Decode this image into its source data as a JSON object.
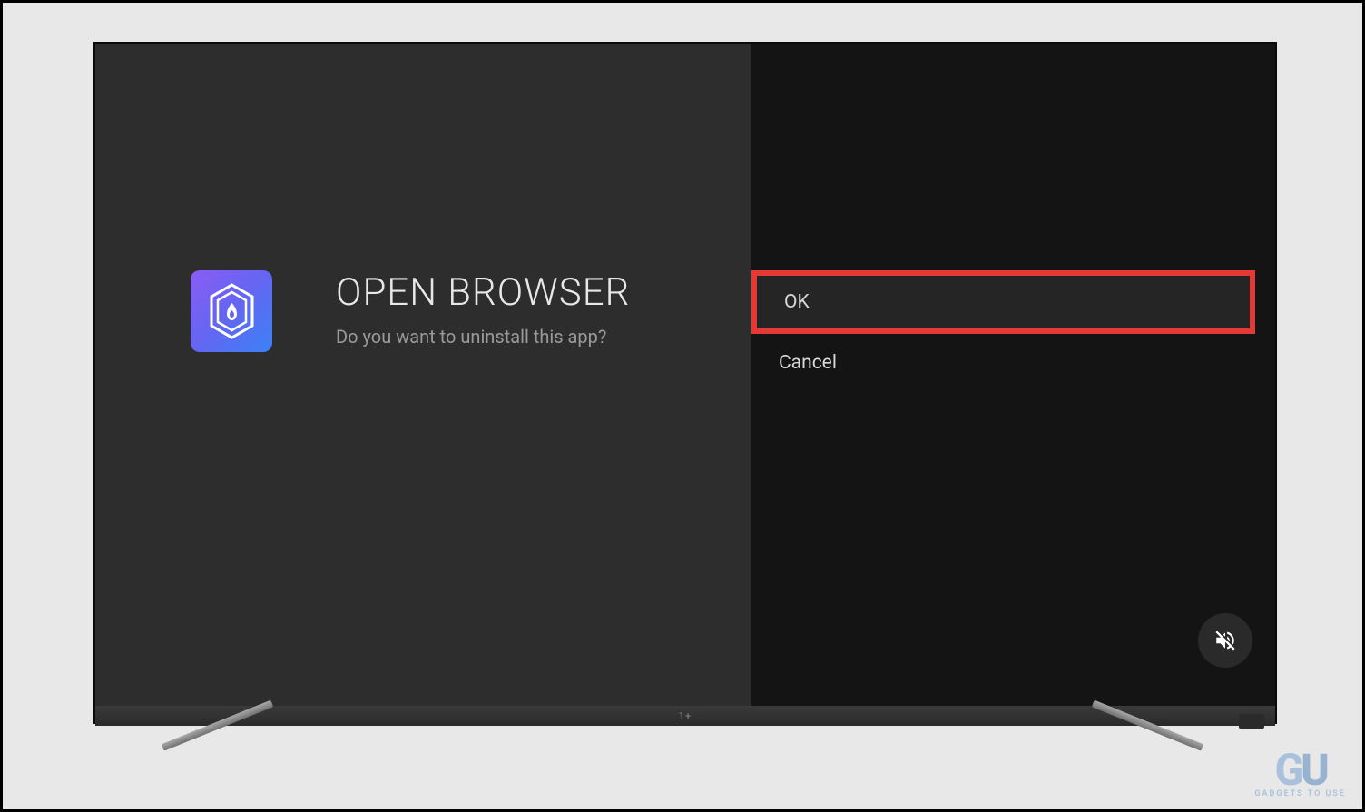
{
  "dialog": {
    "app_title": "OPEN BROWSER",
    "prompt": "Do you want to uninstall this app?"
  },
  "actions": {
    "ok_label": "OK",
    "cancel_label": "Cancel"
  },
  "watermark": {
    "logo": "GU",
    "text": "GADGETS TO USE"
  },
  "tv": {
    "brand_symbol": "1+"
  }
}
